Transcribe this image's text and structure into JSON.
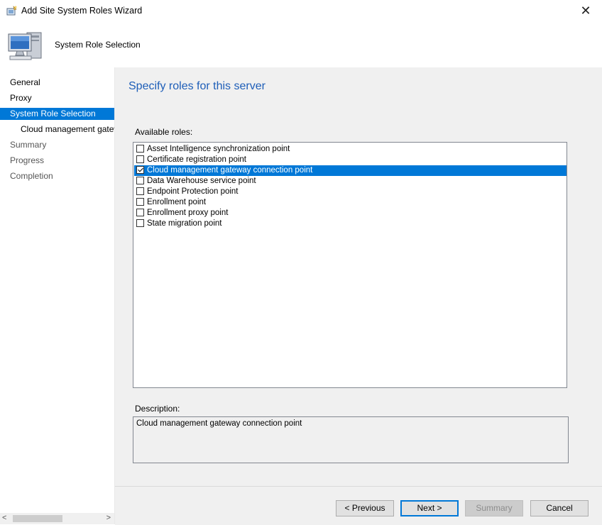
{
  "window": {
    "title": "Add Site System Roles Wizard",
    "close_glyph": "✕"
  },
  "header": {
    "title": "System Role Selection",
    "icon": "computer-icon"
  },
  "nav": {
    "items": [
      {
        "label": "General"
      },
      {
        "label": "Proxy"
      },
      {
        "label": "System Role Selection"
      },
      {
        "label": "Cloud management gateway connection point"
      },
      {
        "label": "Summary"
      },
      {
        "label": "Progress"
      },
      {
        "label": "Completion"
      }
    ]
  },
  "main": {
    "heading": "Specify roles for this server",
    "available_label": "Available roles:",
    "roles": [
      {
        "label": "Asset Intelligence synchronization point",
        "checked": false
      },
      {
        "label": "Certificate registration point",
        "checked": false
      },
      {
        "label": "Cloud management gateway connection point",
        "checked": true
      },
      {
        "label": "Data Warehouse service point",
        "checked": false
      },
      {
        "label": "Endpoint Protection point",
        "checked": false
      },
      {
        "label": "Enrollment point",
        "checked": false
      },
      {
        "label": "Enrollment proxy point",
        "checked": false
      },
      {
        "label": "State migration point",
        "checked": false
      }
    ],
    "description_label": "Description:",
    "description": "Cloud management gateway connection point"
  },
  "buttons": {
    "previous": "< Previous",
    "next": "Next >",
    "summary": "Summary",
    "cancel": "Cancel"
  },
  "scroll": {
    "left_glyph": "<",
    "right_glyph": ">"
  },
  "colors": {
    "selection": "#0078d7",
    "heading": "#1e5eb8",
    "panel": "#f0f0f0"
  }
}
